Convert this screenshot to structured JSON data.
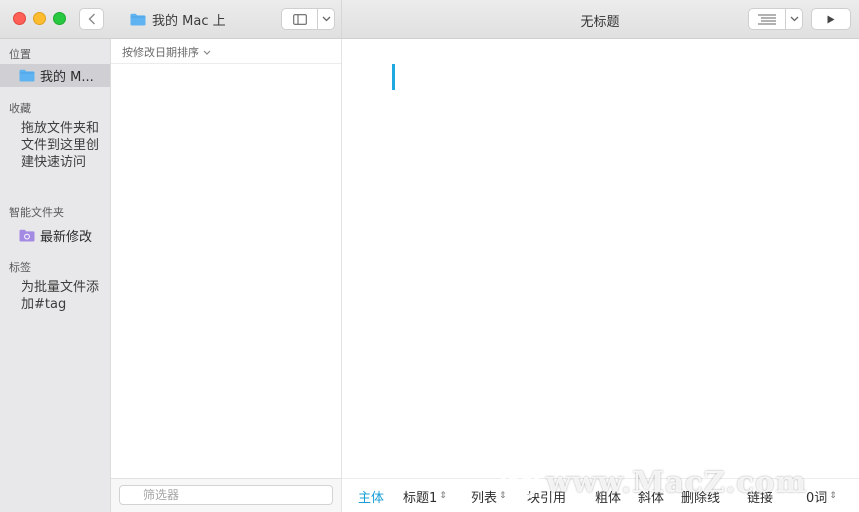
{
  "titlebar": {
    "folder_title": "我的 Mac 上",
    "window_title": "无标题",
    "icons": [
      "back-icon",
      "folder-icon",
      "sidebar-layout-icon",
      "chevron-down-icon",
      "outline-icon",
      "play-icon"
    ]
  },
  "sidebar": {
    "location_header": "位置",
    "location_item": "我的 M...",
    "favorites_header": "收藏",
    "favorites_hint": "拖放文件夹和文件到这里创建快速访问",
    "smart_header": "智能文件夹",
    "smart_item": "最新修改",
    "tags_header": "标签",
    "tags_hint": "为批量文件添加#tag"
  },
  "note_list": {
    "sort_label": "按修改日期排序",
    "filter_placeholder": "筛选器"
  },
  "format_bar": {
    "body": "主体",
    "heading": "标题1",
    "list": "列表",
    "quote": "块引用",
    "bold": "粗体",
    "italic": "斜体",
    "strike": "删除线",
    "link": "链接",
    "words": "0词"
  },
  "watermark": {
    "text": "www.MacZ.com"
  },
  "colors": {
    "accent": "#1c9fd6",
    "cursor": "#1fa9e0",
    "sidebar_bg": "#e8e8ea",
    "selected_bg": "#d0d0d4"
  }
}
